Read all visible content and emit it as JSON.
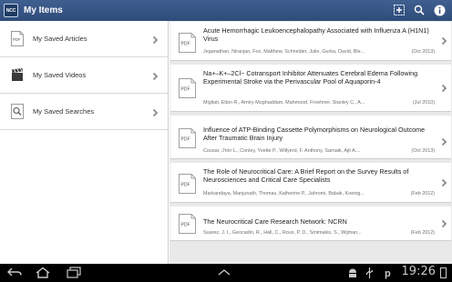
{
  "header": {
    "app_icon_label": "NCC",
    "title": "My Items",
    "actions": [
      "add-bookmark-icon",
      "search-icon",
      "info-icon"
    ]
  },
  "sidebar": {
    "items": [
      {
        "label": "My Saved Articles",
        "icon": "pdf-document-icon",
        "icon_text": "PDF"
      },
      {
        "label": "My Saved Videos",
        "icon": "video-clapper-icon"
      },
      {
        "label": "My Saved Searches",
        "icon": "search-icon"
      }
    ]
  },
  "articles": [
    {
      "doc_label": "PDF",
      "title": "Acute Hemorrhagic Leukoencephalopathy Associated with Influenza A (H1N1) Virus",
      "authors": "Jeganathan, Niranjan, Fox, Matthew, Schneider, Julie, Gurka, David, Ble...",
      "date": "(Oct 2013)"
    },
    {
      "doc_label": "PDF",
      "title": "Na+–K+–2Cl− Cotransport Inhibitor Attenuates Cerebral Edema Following Experimental Stroke via the Perivascular Pool of Aquaporin-4",
      "authors": "Migliati, Elton R., Amiry-Moghaddam, Mahmood, Froehner, Stanley C., A...",
      "date": "(Jul 2010)"
    },
    {
      "doc_label": "PDF",
      "title": "Influence of ATP-Binding Cassette Polymorphisms on Neurological Outcome After Traumatic Brain Injury",
      "authors": "Cousar, J'mir L., Conley, Yvette P., Willyerd, F. Anthony, Sarnaik, Ajit A....",
      "date": "(Oct 2013)"
    },
    {
      "doc_label": "PDF",
      "title": "The Role of Neurocritical Care: A Brief Report on the Survey Results of Neurosciences and Critical Care Specialists",
      "authors": "Markandaya, Manjunath, Thomas, Katherine P., Jahromi, Babak, Koenig...",
      "date": "(Feb 2012)"
    },
    {
      "doc_label": "PDF",
      "title": "The Neurocritical Care Research Network: NCRN",
      "authors": "Suarez, J. I., Geocadin, R., Hall, C., Roux, P. D., Smimakis, S., Wijman...",
      "date": "(Feb 2012)"
    }
  ],
  "system_bar": {
    "time": "19:26",
    "nav_icons": [
      "back-icon",
      "home-icon",
      "recent-apps-icon",
      "menu-up-icon"
    ],
    "status_icons": [
      "android-debug-icon",
      "usb-icon",
      "p-notification-icon",
      "battery-icon"
    ]
  },
  "colors": {
    "action_bar": "#2f4c7a",
    "list_background": "#e9e9e9",
    "system_bar": "#000000"
  }
}
